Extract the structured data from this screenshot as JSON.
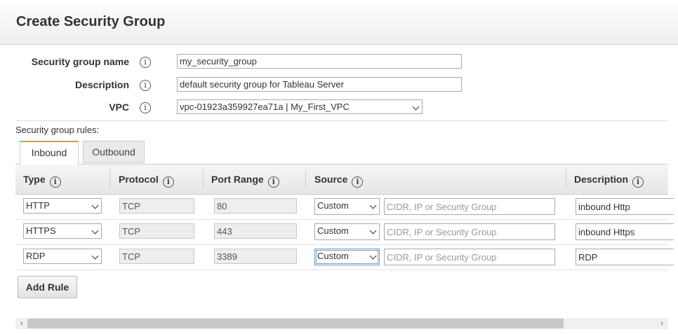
{
  "dialog": {
    "title": "Create Security Group"
  },
  "form": {
    "name_label": "Security group name",
    "name_value": "my_security_group",
    "description_label": "Description",
    "description_value": "default security group for Tableau Server",
    "vpc_label": "VPC",
    "vpc_value": "vpc-01923a359927ea71a | My_First_VPC"
  },
  "rules": {
    "label": "Security group rules:",
    "tabs": [
      {
        "label": "Inbound",
        "active": true
      },
      {
        "label": "Outbound",
        "active": false
      }
    ],
    "columns": [
      "Type",
      "Protocol",
      "Port Range",
      "Source",
      "Description"
    ],
    "source_placeholder": "CIDR, IP or Security Group",
    "rows": [
      {
        "type": "HTTP",
        "protocol": "TCP",
        "port": "80",
        "source": "Custom",
        "description": "inbound Http"
      },
      {
        "type": "HTTPS",
        "protocol": "TCP",
        "port": "443",
        "source": "Custom",
        "description": "inbound Https"
      },
      {
        "type": "RDP",
        "protocol": "TCP",
        "port": "3389",
        "source": "Custom",
        "description": "RDP"
      }
    ],
    "add_rule_label": "Add Rule"
  },
  "icons": {
    "info": "i",
    "scroll_left": "‹",
    "scroll_right": "›"
  },
  "colors": {
    "active_tab_accent": "#e79731"
  }
}
